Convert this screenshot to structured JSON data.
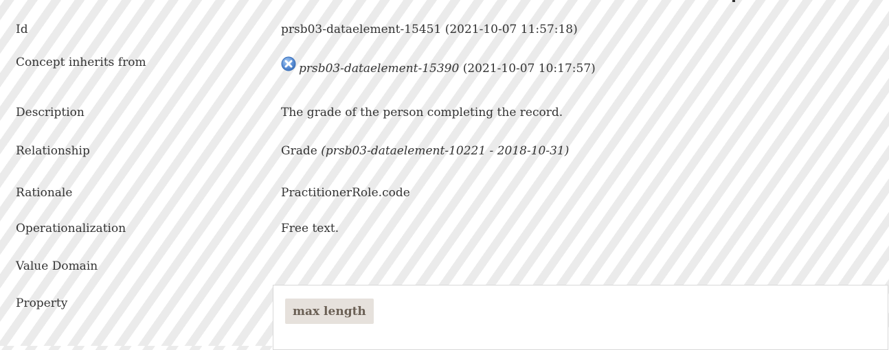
{
  "rows": [
    {
      "label": "Id",
      "value": "prsb03-dataelement-15451 (2021-10-07 11:57:18)"
    },
    {
      "label": "Concept inherits from",
      "inherit_link": "prsb03-dataelement-15390",
      "inherit_date": " (2021-10-07 10:17:57)"
    },
    {
      "label": "Description",
      "value": "The grade of the person completing the record."
    },
    {
      "label": "Relationship",
      "value_plain": "Grade ",
      "value_italic": "(prsb03-dataelement-10221 - 2018-10-31)"
    },
    {
      "label": "Rationale",
      "value": "PractitionerRole.code"
    },
    {
      "label": "Operationalization",
      "value": "Free text."
    },
    {
      "label": "Value Domain",
      "value": ""
    },
    {
      "label": "Property"
    }
  ],
  "property": {
    "tag": "max length"
  },
  "icons": {
    "inherit_icon": "close-circle-icon",
    "inherit_icon_color": "#5b8fd6"
  }
}
